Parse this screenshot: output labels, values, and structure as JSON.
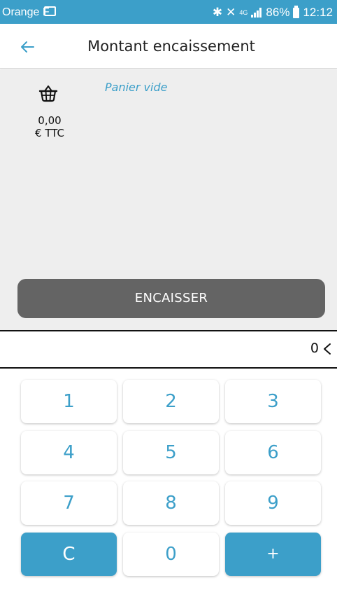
{
  "status_bar": {
    "carrier": "Orange F",
    "network": "4G",
    "battery": "86%",
    "time": "12:12"
  },
  "header": {
    "title": "Montant encaissement"
  },
  "cart": {
    "total_amount": "0,00",
    "currency_label": "€ TTC",
    "empty_label": "Panier vide",
    "checkout_button": "ENCAISSER"
  },
  "display": {
    "value": "0"
  },
  "keypad": {
    "keys": [
      "1",
      "2",
      "3",
      "4",
      "5",
      "6",
      "7",
      "8",
      "9",
      "C",
      "0",
      "+"
    ]
  },
  "colors": {
    "accent": "#3c9fc9",
    "checkout_button": "#646464",
    "cart_background": "#eeeeee"
  }
}
